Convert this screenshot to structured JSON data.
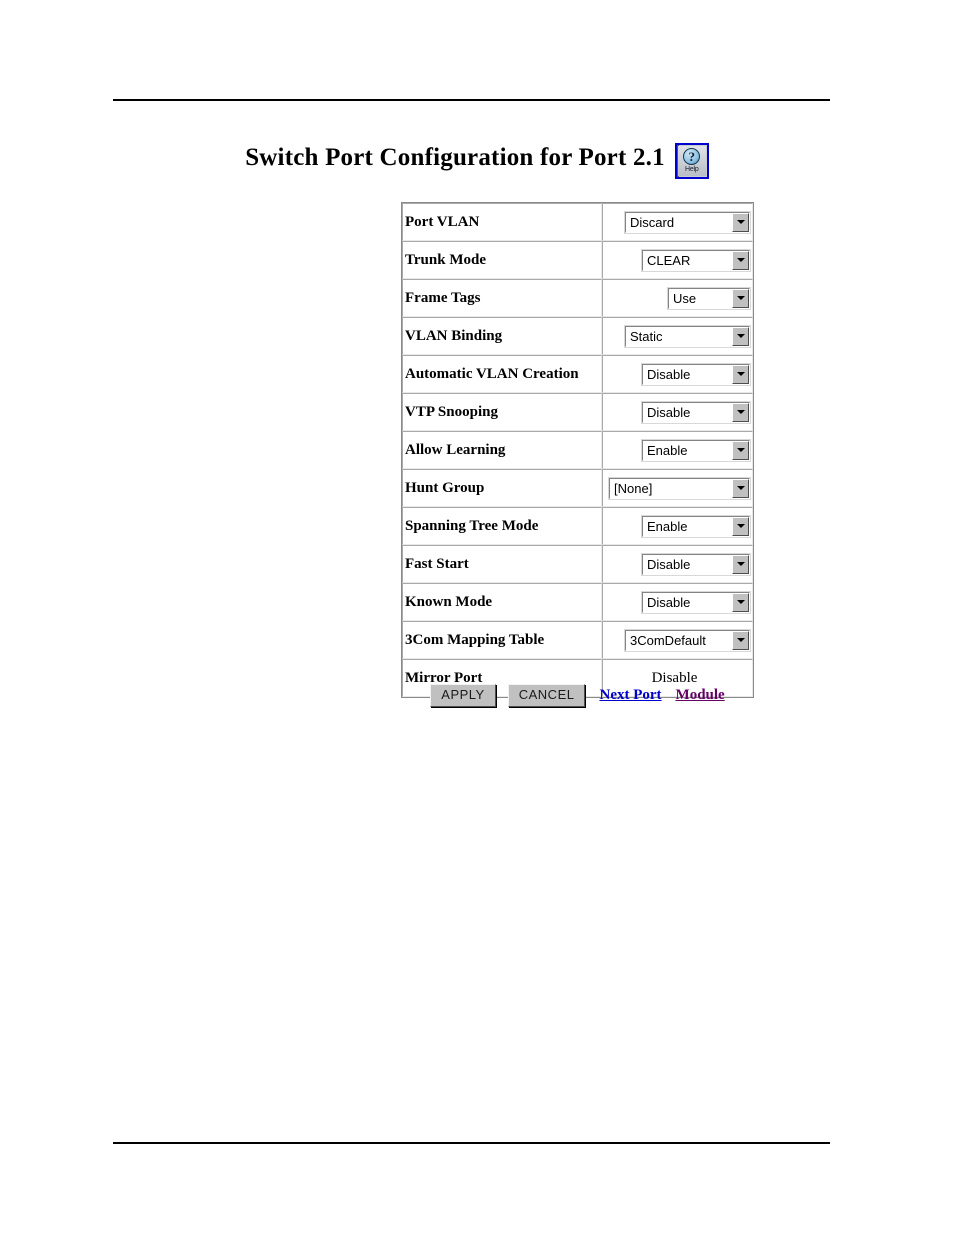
{
  "page": {
    "title": "Switch Port Configuration for Port 2.1",
    "help_icon_label": "Help",
    "help_icon_glyph": "?",
    "accent_link_color": "#0000CC",
    "visited_link_color": "#660066",
    "help_border_color": "#0000CC"
  },
  "table": {
    "rows": [
      {
        "label": "Port VLAN",
        "value": "Discard",
        "control": "select",
        "width": "lg"
      },
      {
        "label": "Trunk Mode",
        "value": "CLEAR",
        "control": "select",
        "width": "md"
      },
      {
        "label": "Frame Tags",
        "value": "Use",
        "control": "select",
        "width": "sm"
      },
      {
        "label": "VLAN Binding",
        "value": "Static",
        "control": "select",
        "width": "lg"
      },
      {
        "label": "Automatic VLAN Creation",
        "value": "Disable",
        "control": "select",
        "width": "md"
      },
      {
        "label": "VTP Snooping",
        "value": "Disable",
        "control": "select",
        "width": "md"
      },
      {
        "label": "Allow Learning",
        "value": "Enable",
        "control": "select",
        "width": "md"
      },
      {
        "label": "Hunt Group",
        "value": "[None]",
        "control": "select",
        "width": "xl"
      },
      {
        "label": "Spanning Tree Mode",
        "value": "Enable",
        "control": "select",
        "width": "md"
      },
      {
        "label": "Fast Start",
        "value": "Disable",
        "control": "select",
        "width": "md"
      },
      {
        "label": "Known Mode",
        "value": "Disable",
        "control": "select",
        "width": "md"
      },
      {
        "label": "3Com Mapping Table",
        "value": "3ComDefault",
        "control": "select",
        "width": "lg"
      },
      {
        "label": "Mirror Port",
        "value": "Disable",
        "control": "text",
        "width": ""
      }
    ]
  },
  "actions": {
    "apply_label": "APPLY",
    "cancel_label": "CANCEL",
    "next_port_label": "Next Port",
    "module_label": "Module"
  }
}
